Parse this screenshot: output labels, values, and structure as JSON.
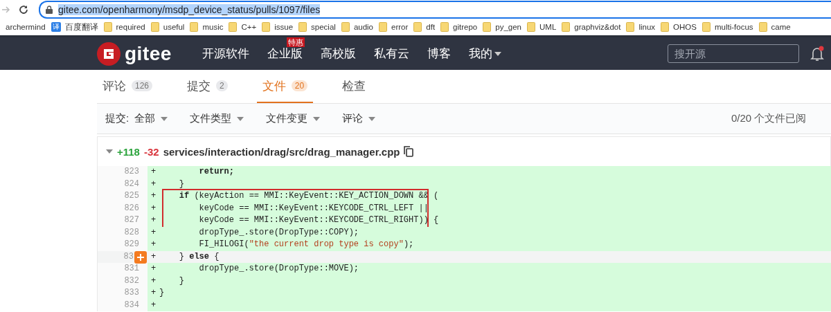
{
  "browser": {
    "url": "gitee.com/openharmony/msdp_device_status/pulls/1097/files",
    "url_selected": true,
    "bookmarks": [
      {
        "label": "archermind",
        "kind": "plain"
      },
      {
        "label": "百度翻译",
        "kind": "app",
        "icon_text": "译"
      },
      {
        "label": "required",
        "kind": "folder"
      },
      {
        "label": "useful",
        "kind": "folder"
      },
      {
        "label": "music",
        "kind": "folder"
      },
      {
        "label": "C++",
        "kind": "folder"
      },
      {
        "label": "issue",
        "kind": "folder"
      },
      {
        "label": "special",
        "kind": "folder"
      },
      {
        "label": "audio",
        "kind": "folder"
      },
      {
        "label": "error",
        "kind": "folder"
      },
      {
        "label": "dft",
        "kind": "folder"
      },
      {
        "label": "gitrepo",
        "kind": "folder"
      },
      {
        "label": "py_gen",
        "kind": "folder"
      },
      {
        "label": "UML",
        "kind": "folder"
      },
      {
        "label": "graphviz&dot",
        "kind": "folder"
      },
      {
        "label": "linux",
        "kind": "folder"
      },
      {
        "label": "OHOS",
        "kind": "folder"
      },
      {
        "label": "multi-focus",
        "kind": "folder"
      },
      {
        "label": "came",
        "kind": "folder"
      }
    ]
  },
  "site_header": {
    "logo_text": "gitee",
    "nav": [
      {
        "label": "开源软件"
      },
      {
        "label": "企业版",
        "badge": "特惠"
      },
      {
        "label": "高校版"
      },
      {
        "label": "私有云"
      },
      {
        "label": "博客"
      },
      {
        "label": "我的",
        "dropdown": true
      }
    ],
    "search": {
      "placeholder": "搜开源"
    },
    "notification_dot": true
  },
  "tabs": [
    {
      "label": "评论",
      "count": "126",
      "selected": false
    },
    {
      "label": "提交",
      "count": "2",
      "selected": false
    },
    {
      "label": "文件",
      "count": "20",
      "selected": true
    },
    {
      "label": "检查",
      "selected": false
    }
  ],
  "filters": {
    "items": [
      {
        "label": "提交:",
        "value": "全部"
      },
      {
        "label": "文件类型"
      },
      {
        "label": "文件变更"
      },
      {
        "label": "评论"
      }
    ],
    "viewed": "0/20 个文件已阅"
  },
  "file": {
    "additions": "+118",
    "deletions": "-32",
    "path": "services/interaction/drag/src/drag_manager.cpp",
    "expanded": true,
    "lines": [
      {
        "number": "823",
        "sign": "+",
        "segments": [
          {
            "text": "        return;",
            "kind": "keyword"
          }
        ]
      },
      {
        "number": "824",
        "sign": "+",
        "segments": [
          {
            "text": "    }",
            "kind": "plain"
          }
        ]
      },
      {
        "number": "825",
        "sign": "+",
        "boxed": true,
        "segments": [
          {
            "text": "    if",
            "kind": "keyword"
          },
          {
            "text": " (keyAction == MMI::KeyEvent::KEY_ACTION_DOWN && (",
            "kind": "plain"
          }
        ]
      },
      {
        "number": "826",
        "sign": "+",
        "boxed": true,
        "segments": [
          {
            "text": "        keyCode == MMI::KeyEvent::KEYCODE_CTRL_LEFT ||",
            "kind": "plain"
          }
        ]
      },
      {
        "number": "827",
        "sign": "+",
        "boxed": true,
        "segments": [
          {
            "text": "        keyCode == MMI::KeyEvent::KEYCODE_CTRL_RIGHT)) {",
            "kind": "plain"
          }
        ]
      },
      {
        "number": "828",
        "sign": "+",
        "segments": [
          {
            "text": "        dropType_.store(DropType::COPY);",
            "kind": "plain"
          }
        ]
      },
      {
        "number": "829",
        "sign": "+",
        "segments": [
          {
            "text": "        FI_HILOGI(",
            "kind": "plain"
          },
          {
            "text": "\"the current drop type is copy\"",
            "kind": "string"
          },
          {
            "text": ");",
            "kind": "plain"
          }
        ]
      },
      {
        "number": "83",
        "sign": "+",
        "hovered": true,
        "segments": [
          {
            "text": "    } ",
            "kind": "plain"
          },
          {
            "text": "else",
            "kind": "keyword"
          },
          {
            "text": " {",
            "kind": "plain"
          }
        ]
      },
      {
        "number": "831",
        "sign": "+",
        "segments": [
          {
            "text": "        dropType_.store(DropType::MOVE);",
            "kind": "plain"
          }
        ]
      },
      {
        "number": "832",
        "sign": "+",
        "segments": [
          {
            "text": "    }",
            "kind": "plain"
          }
        ]
      },
      {
        "number": "833",
        "sign": "+",
        "segments": [
          {
            "text": "}",
            "kind": "plain"
          }
        ]
      },
      {
        "number": "834",
        "sign": "+"
      }
    ]
  }
}
